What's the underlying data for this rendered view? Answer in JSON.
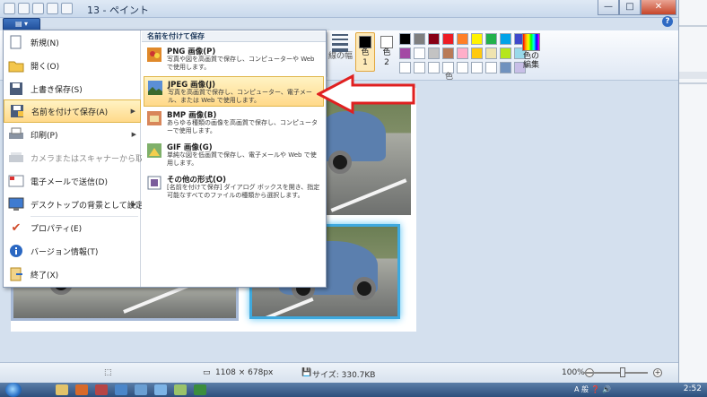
{
  "window": {
    "title": "13 - ペイント",
    "minimize": "—",
    "maximize": "□",
    "close": "✕"
  },
  "ribbon": {
    "size_label": "線の幅",
    "color1_label": "色\n1",
    "color2_label": "色\n2",
    "palette_label": "色",
    "edit_colors_label": "色の\n編集",
    "color1": "#000000",
    "color2": "#ffffff",
    "palette_colors": [
      "#000000",
      "#7f7f7f",
      "#880015",
      "#ed1c24",
      "#ff7f27",
      "#fff200",
      "#22b14c",
      "#00a2e8",
      "#3f48cc",
      "#a349a4",
      "#ffffff",
      "#c3c3c3",
      "#b97a57",
      "#ffaec9",
      "#ffc90e",
      "#efe4b0",
      "#b5e61d",
      "#99d9ea",
      "#7092be",
      "#c8bfe7"
    ],
    "help": "?"
  },
  "file_button": "▤ ▾",
  "menu": {
    "items": [
      {
        "label": "新規(N)",
        "icon": "new-file-icon"
      },
      {
        "label": "開く(O)",
        "icon": "open-folder-icon"
      },
      {
        "label": "上書き保存(S)",
        "icon": "save-icon"
      },
      {
        "label": "名前を付けて保存(A)",
        "icon": "save-as-icon"
      },
      {
        "label": "印刷(P)",
        "icon": "print-icon"
      },
      {
        "label": "カメラまたはスキャナーから取り込み(M)",
        "icon": "scanner-icon"
      },
      {
        "label": "電子メールで送信(D)",
        "icon": "email-icon"
      },
      {
        "label": "デスクトップの背景として設定(B)",
        "icon": "desktop-background-icon"
      },
      {
        "label": "プロパティ(E)",
        "icon": "properties-check-icon"
      },
      {
        "label": "バージョン情報(T)",
        "icon": "info-icon"
      },
      {
        "label": "終了(X)",
        "icon": "exit-icon"
      }
    ],
    "submenu_header": "名前を付けて保存",
    "submenu": [
      {
        "title": "PNG 画像(P)",
        "desc": "写真や図を高画質で保存し、コンピューターや Web で使用します。"
      },
      {
        "title": "JPEG 画像(J)",
        "desc": "写真を高画質で保存し、コンピューター、電子メール、または Web で使用します。"
      },
      {
        "title": "BMP 画像(B)",
        "desc": "あらゆる種類の画像を高画質で保存し、コンピューターで使用します。"
      },
      {
        "title": "GIF 画像(G)",
        "desc": "単純な図を低画質で保存し、電子メールや Web で使用します。"
      },
      {
        "title": "その他の形式(O)",
        "desc": "[名前を付けて保存] ダイアログ ボックスを開き、指定可能なすべてのファイルの種類から選択します。"
      }
    ]
  },
  "status": {
    "dimensions": "1108 × 678px",
    "size": "サイズ: 330.7KB",
    "zoom": "100%",
    "zoom_minus": "−",
    "zoom_plus": "+"
  },
  "taskbar": {
    "clock": "2:52",
    "tray": "A 般 ❓ 🔊"
  }
}
